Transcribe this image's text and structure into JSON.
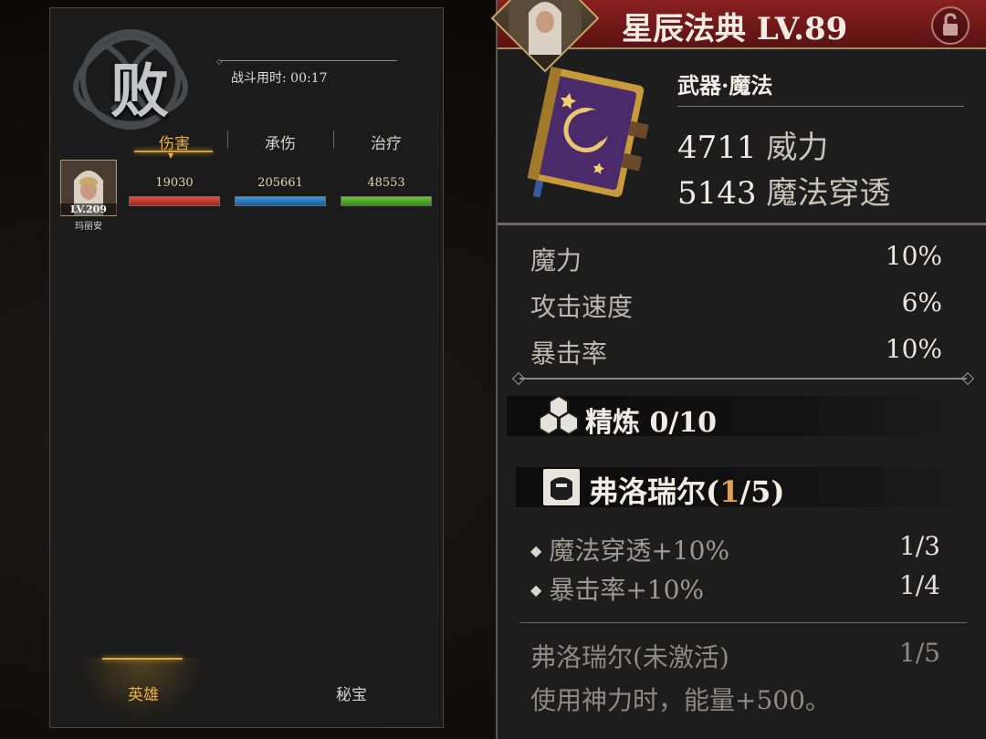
{
  "battle": {
    "result": "败",
    "time_label": "战斗用时: 00:17",
    "tabs": [
      "伤害",
      "承伤",
      "治疗"
    ],
    "hero": {
      "level": "LV.209",
      "name": "玛丽安"
    },
    "stats": {
      "damage": "19030",
      "taken": "205661",
      "heal": "48553"
    },
    "bottom_tabs": {
      "hero": "英雄",
      "treasure": "秘宝"
    }
  },
  "item": {
    "title": "星辰法典 LV.89",
    "type": "武器·魔法",
    "main_stats": [
      {
        "value": "4711",
        "label": "威力"
      },
      {
        "value": "5143",
        "label": "魔法穿透"
      }
    ],
    "sub_stats": [
      {
        "label": "魔力",
        "value": "10%"
      },
      {
        "label": "攻击速度",
        "value": "6%"
      },
      {
        "label": "暴击率",
        "value": "10%"
      }
    ],
    "refine": "精炼 0/10",
    "set": {
      "name_prefix": "弗洛瑞尔(",
      "current": "1",
      "name_suffix": "/5)"
    },
    "set_bonuses": [
      {
        "label": "魔法穿透+10%",
        "value": "1/3"
      },
      {
        "label": "暴击率+10%",
        "value": "1/4"
      }
    ],
    "set_skill": {
      "label": "弗洛瑞尔(未激活)",
      "value": "1/5",
      "desc": "使用神力时，能量+500。"
    }
  }
}
